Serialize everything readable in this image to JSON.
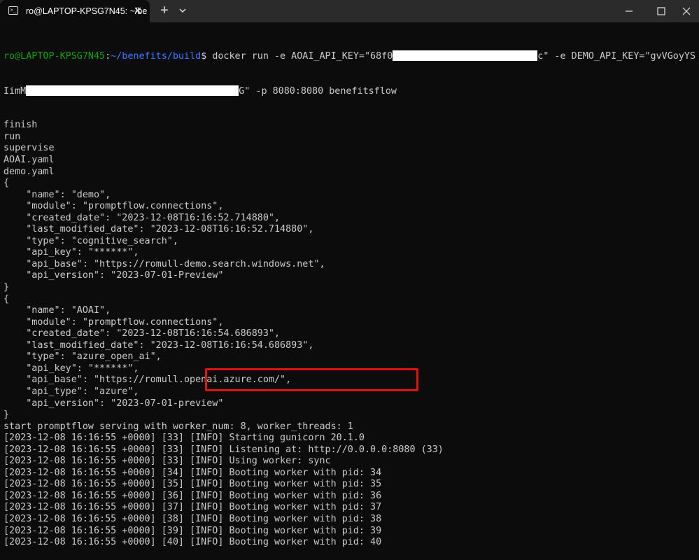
{
  "window": {
    "tab_title": "ro@LAPTOP-KPSG7N45: ~/be",
    "tab_icon": "terminal-icon",
    "close_tab_icon": "close-icon",
    "new_tab_label": "+",
    "minimize_icon": "minimize-icon",
    "maximize_icon": "maximize-icon",
    "close_window_icon": "close-icon"
  },
  "colors": {
    "background": "#0c0c0c",
    "text": "#cccccc",
    "prompt_user": "#13a10e",
    "prompt_path": "#3b78ff",
    "highlight_box": "#e01414"
  },
  "terminal": {
    "prompt_user": "ro@LAPTOP-KPSG7N45",
    "prompt_sep": ":",
    "prompt_path": "~/benefits/build",
    "prompt_end": "$ ",
    "command_part1": "docker run -e AOAI_API_KEY=\"68f0",
    "command_part2": "c\" -e DEMO_API_KEY=\"gvVGoyYS",
    "command_part3": "IimM",
    "command_part4": "G\" -p 8080:8080 benefitsflow",
    "lines": [
      "finish",
      "run",
      "supervise",
      "AOAI.yaml",
      "demo.yaml",
      "{",
      "    \"name\": \"demo\",",
      "    \"module\": \"promptflow.connections\",",
      "    \"created_date\": \"2023-12-08T16:16:52.714880\",",
      "    \"last_modified_date\": \"2023-12-08T16:16:52.714880\",",
      "    \"type\": \"cognitive_search\",",
      "    \"api_key\": \"******\",",
      "    \"api_base\": \"https://romull-demo.search.windows.net\",",
      "    \"api_version\": \"2023-07-01-Preview\"",
      "}",
      "{",
      "    \"name\": \"AOAI\",",
      "    \"module\": \"promptflow.connections\",",
      "    \"created_date\": \"2023-12-08T16:16:54.686893\",",
      "    \"last_modified_date\": \"2023-12-08T16:16:54.686893\",",
      "    \"type\": \"azure_open_ai\",",
      "    \"api_key\": \"******\",",
      "    \"api_base\": \"https://romull.openai.azure.com/\",",
      "    \"api_type\": \"azure\",",
      "    \"api_version\": \"2023-07-01-preview\"",
      "}",
      "start promptflow serving with worker_num: 8, worker_threads: 1",
      "[2023-12-08 16:16:55 +0000] [33] [INFO] Starting gunicorn 20.1.0",
      "[2023-12-08 16:16:55 +0000] [33] [INFO] Listening at: http://0.0.0.0:8080 (33)",
      "[2023-12-08 16:16:55 +0000] [33] [INFO] Using worker: sync",
      "[2023-12-08 16:16:55 +0000] [34] [INFO] Booting worker with pid: 34",
      "[2023-12-08 16:16:55 +0000] [35] [INFO] Booting worker with pid: 35",
      "[2023-12-08 16:16:55 +0000] [36] [INFO] Booting worker with pid: 36",
      "[2023-12-08 16:16:55 +0000] [37] [INFO] Booting worker with pid: 37",
      "[2023-12-08 16:16:55 +0000] [38] [INFO] Booting worker with pid: 38",
      "[2023-12-08 16:16:55 +0000] [39] [INFO] Booting worker with pid: 39",
      "[2023-12-08 16:16:55 +0000] [40] [INFO] Booting worker with pid: 40"
    ]
  }
}
